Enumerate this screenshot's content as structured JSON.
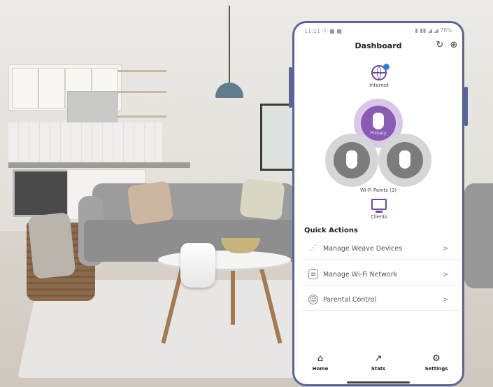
{
  "status_bar": {
    "left": "11:11 ⓔ ■ ■",
    "right": "▮ ▮▮ ◢ ◢ 78%"
  },
  "header": {
    "title": "Dashboard",
    "refresh_icon": "refresh-icon",
    "add_icon": "plus-circle-icon"
  },
  "network": {
    "internet_label": "Internet",
    "main_node_label": "Primary",
    "wifi_points_label": "Wi-Fi Points (3)",
    "clients_label": "Clients"
  },
  "quick_actions": {
    "title": "Quick Actions",
    "items": [
      {
        "label": "Manage Weave Devices",
        "icon": "weave-icon"
      },
      {
        "label": "Manage Wi-Fi Network",
        "icon": "wifi-network-icon"
      },
      {
        "label": "Parental Control",
        "icon": "parental-control-icon"
      }
    ]
  },
  "tabs": [
    {
      "label": "Home",
      "icon": "home-icon"
    },
    {
      "label": "Stats",
      "icon": "stats-icon"
    },
    {
      "label": "Settings",
      "icon": "settings-icon"
    }
  ],
  "colors": {
    "accent": "#6d4a9e",
    "phone_frame": "#59659a"
  }
}
